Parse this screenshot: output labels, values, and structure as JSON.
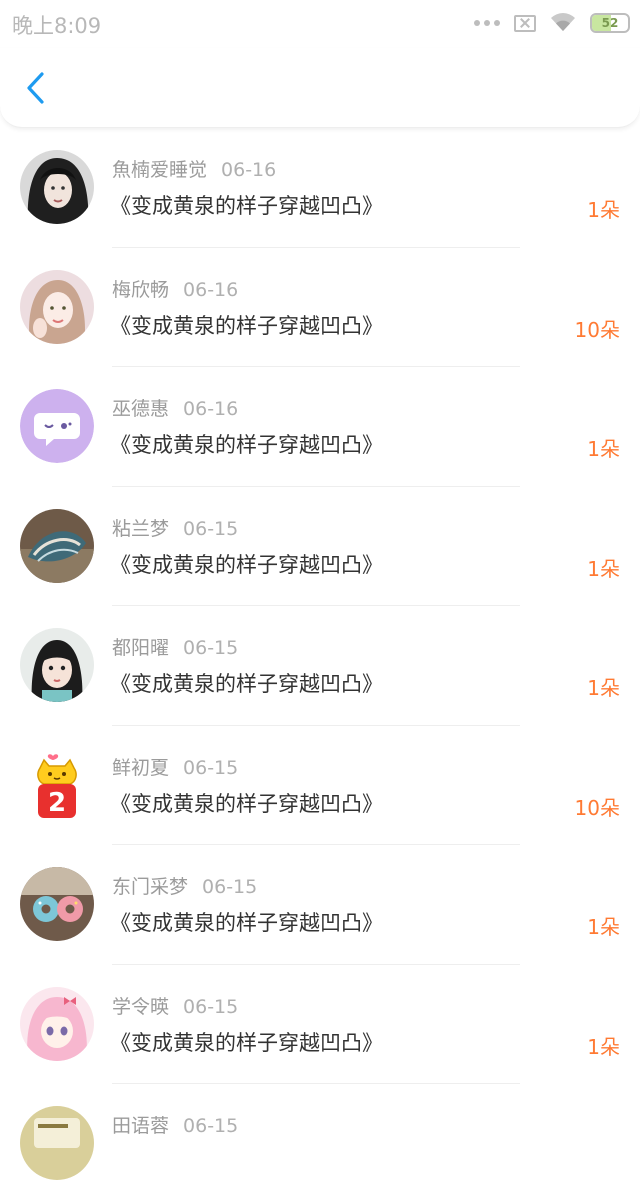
{
  "status_bar": {
    "time": "晚上8:09",
    "battery_level": "52",
    "battery_fraction": 0.52,
    "icons": [
      "more-dots-icon",
      "no-sim-icon",
      "wifi-icon",
      "battery-icon"
    ]
  },
  "nav": {
    "back_icon": "chevron-left-icon",
    "accent_color": "#1e9bf0"
  },
  "colors": {
    "amount": "#ff7a33",
    "name": "#9b9b9b",
    "title": "#333333"
  },
  "gifts": [
    {
      "name": "魚楠爱睡觉",
      "date": "06-16",
      "title": "《变成黄泉的样子穿越凹凸》",
      "amount": "1朵",
      "avatar": "photo-avatar"
    },
    {
      "name": "梅欣畅",
      "date": "06-16",
      "title": "《变成黄泉的样子穿越凹凸》",
      "amount": "10朵",
      "avatar": "photo-avatar"
    },
    {
      "name": "巫德惠",
      "date": "06-16",
      "title": "《变成黄泉的样子穿越凹凸》",
      "amount": "1朵",
      "avatar": "chat-bubble-avatar"
    },
    {
      "name": "粘兰梦",
      "date": "06-15",
      "title": "《变成黄泉的样子穿越凹凸》",
      "amount": "1朵",
      "avatar": "photo-avatar"
    },
    {
      "name": "都阳曜",
      "date": "06-15",
      "title": "《变成黄泉的样子穿越凹凸》",
      "amount": "1朵",
      "avatar": "photo-avatar"
    },
    {
      "name": "鲜初夏",
      "date": "06-15",
      "title": "《变成黄泉的样子穿越凹凸》",
      "amount": "10朵",
      "avatar": "cat-number-two-avatar"
    },
    {
      "name": "东门采梦",
      "date": "06-15",
      "title": "《变成黄泉的样子穿越凹凸》",
      "amount": "1朵",
      "avatar": "donut-photo-avatar"
    },
    {
      "name": "学令暎",
      "date": "06-15",
      "title": "《变成黄泉的样子穿越凹凸》",
      "amount": "1朵",
      "avatar": "anime-girl-avatar"
    },
    {
      "name": "田语蓉",
      "date": "06-15",
      "title": "",
      "amount": "",
      "avatar": "photo-avatar"
    }
  ]
}
